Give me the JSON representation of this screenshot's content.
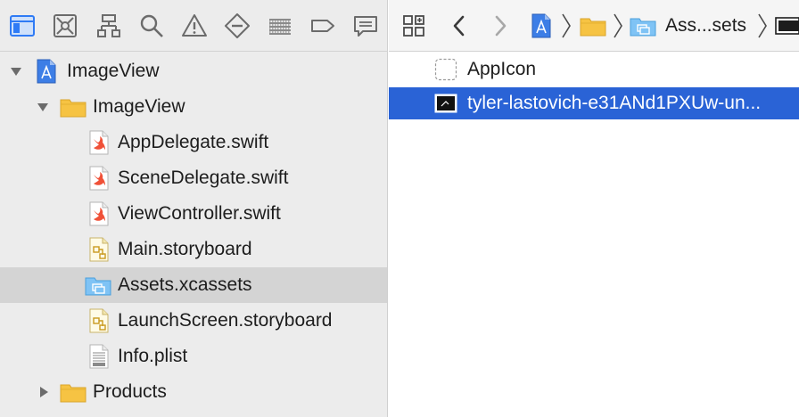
{
  "navigator": {
    "toolbar_icons": [
      {
        "name": "project-navigator-icon",
        "active": true
      },
      {
        "name": "source-control-navigator-icon"
      },
      {
        "name": "symbol-navigator-icon"
      },
      {
        "name": "find-navigator-icon"
      },
      {
        "name": "issue-navigator-icon"
      },
      {
        "name": "test-navigator-icon"
      },
      {
        "name": "debug-navigator-icon"
      },
      {
        "name": "breakpoint-navigator-icon"
      },
      {
        "name": "report-navigator-icon"
      }
    ],
    "tree": [
      {
        "label": "ImageView",
        "icon": "project-icon",
        "level": 0,
        "disclosure": "open"
      },
      {
        "label": "ImageView",
        "icon": "folder-icon",
        "level": 1,
        "disclosure": "open"
      },
      {
        "label": "AppDelegate.swift",
        "icon": "swift-file-icon",
        "level": 2
      },
      {
        "label": "SceneDelegate.swift",
        "icon": "swift-file-icon",
        "level": 2
      },
      {
        "label": "ViewController.swift",
        "icon": "swift-file-icon",
        "level": 2
      },
      {
        "label": "Main.storyboard",
        "icon": "storyboard-icon",
        "level": 2
      },
      {
        "label": "Assets.xcassets",
        "icon": "asset-catalog-icon",
        "level": 2,
        "selected": true
      },
      {
        "label": "LaunchScreen.storyboard",
        "icon": "storyboard-icon",
        "level": 2
      },
      {
        "label": "Info.plist",
        "icon": "plist-icon",
        "level": 2
      },
      {
        "label": "Products",
        "icon": "folder-icon",
        "level": 1,
        "disclosure": "closed",
        "indent_override": 0
      }
    ]
  },
  "jumpbar": {
    "breadcrumb_label": "Ass...sets"
  },
  "assets": [
    {
      "label": "AppIcon",
      "icon": "app-icon-placeholder-icon"
    },
    {
      "label": "tyler-lastovich-e31ANd1PXUw-un...",
      "icon": "image-set-icon",
      "selected": true
    }
  ],
  "colors": {
    "selection_blue": "#2a63d6",
    "navigator_selection": "#d4d4d4",
    "active_tool": "#2f7bf5",
    "folder_yellow": "#f6c343"
  }
}
